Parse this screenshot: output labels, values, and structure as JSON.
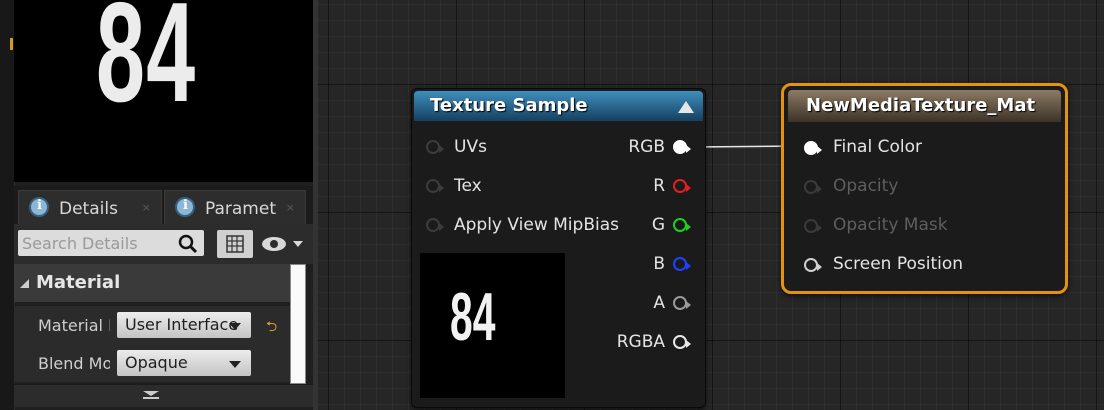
{
  "preview": {
    "value": "84"
  },
  "tabs": [
    {
      "label": "Details",
      "close": "×"
    },
    {
      "label": "Paramet",
      "close": "×"
    }
  ],
  "search": {
    "placeholder": "Search Details"
  },
  "details": {
    "category": "Material",
    "properties": [
      {
        "name": "Material Domain",
        "value": "User Interface",
        "reset": "⮌"
      },
      {
        "name": "Blend Mode",
        "value": "Opaque"
      }
    ]
  },
  "nodes": {
    "texture_sample": {
      "title": "Texture Sample",
      "inputs": [
        "UVs",
        "Tex",
        "Apply View MipBias"
      ],
      "outputs": [
        {
          "label": "RGB",
          "color": "#ffffff"
        },
        {
          "label": "R",
          "color": "#e02020"
        },
        {
          "label": "G",
          "color": "#20d020"
        },
        {
          "label": "B",
          "color": "#2040ff"
        },
        {
          "label": "A",
          "color": "#9a9a9a"
        },
        {
          "label": "RGBA",
          "color": "#ffffff"
        }
      ],
      "thumbnail": "84",
      "header_color": "#1f5d86"
    },
    "material_result": {
      "title": "NewMediaTexture_Mat",
      "inputs": [
        {
          "label": "Final Color",
          "enabled": true
        },
        {
          "label": "Opacity",
          "enabled": false
        },
        {
          "label": "Opacity Mask",
          "enabled": false
        },
        {
          "label": "Screen Position",
          "enabled": true
        }
      ],
      "selection_color": "#e3930e"
    }
  }
}
